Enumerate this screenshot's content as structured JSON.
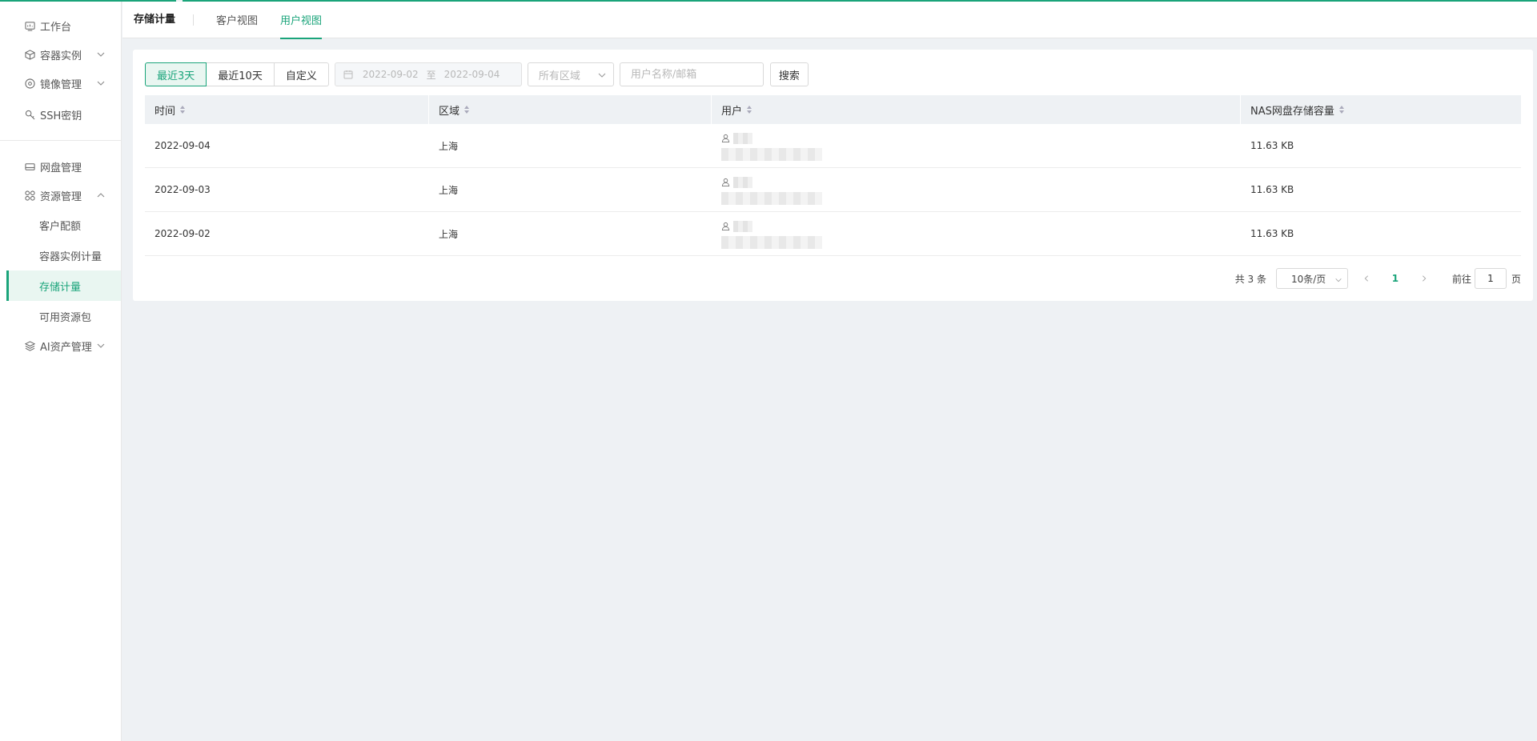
{
  "sidebar": {
    "items": [
      {
        "label": "工作台",
        "icon": "dashboard-icon"
      },
      {
        "label": "容器实例",
        "icon": "cube-icon"
      },
      {
        "label": "镜像管理",
        "icon": "disc-icon"
      },
      {
        "label": "SSH密钥",
        "icon": "key-icon"
      },
      {
        "label": "网盘管理",
        "icon": "drive-icon"
      },
      {
        "label": "资源管理",
        "icon": "grid-icon"
      },
      {
        "label": "AI资产管理",
        "icon": "layers-icon"
      }
    ],
    "sub_items": [
      "客户配额",
      "容器实例计量",
      "存储计量",
      "可用资源包"
    ],
    "active_sub": "存储计量"
  },
  "header": {
    "title": "存储计量",
    "tabs": [
      {
        "label": "客户视图",
        "active": false
      },
      {
        "label": "用户视图",
        "active": true
      }
    ]
  },
  "filters": {
    "ranges": [
      "最近3天",
      "最近10天",
      "自定义"
    ],
    "active_range": "最近3天",
    "date_start": "2022-09-02",
    "date_sep": "至",
    "date_end": "2022-09-04",
    "region_placeholder": "所有区域",
    "user_placeholder": "用户名称/邮箱",
    "search_label": "搜索"
  },
  "table": {
    "columns": [
      "时间",
      "区域",
      "用户",
      "NAS网盘存储容量"
    ],
    "rows": [
      {
        "time": "2022-09-04",
        "region": "上海",
        "capacity": "11.63 KB"
      },
      {
        "time": "2022-09-03",
        "region": "上海",
        "capacity": "11.63 KB"
      },
      {
        "time": "2022-09-02",
        "region": "上海",
        "capacity": "11.63 KB"
      }
    ]
  },
  "pagination": {
    "total": "共 3 条",
    "page_size": "10条/页",
    "current_page": "1",
    "goto_label": "前往",
    "goto_value": "1",
    "page_suffix": "页"
  },
  "colors": {
    "accent": "#1aa47a",
    "background": "#eef1f4"
  }
}
